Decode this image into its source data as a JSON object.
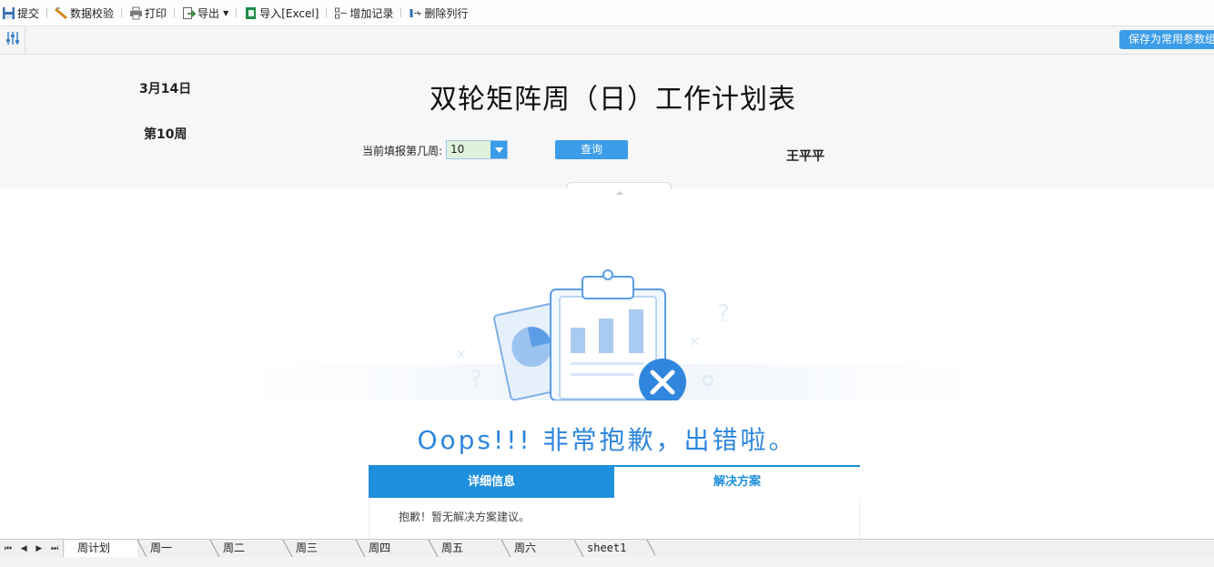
{
  "toolbar": {
    "submit": "提交",
    "validate": "数据校验",
    "print": "打印",
    "export": "导出",
    "import": "导入[Excel]",
    "add_record": "增加记录",
    "delete_row": "删除列行"
  },
  "parambar": {
    "save_params": "保存为常用参数组"
  },
  "panel": {
    "date": "3月14日",
    "week": "第10周",
    "title": "双轮矩阵周（日）工作计划表",
    "week_query_label": "当前填报第几周:",
    "week_value": "10",
    "query_button": "查询",
    "user": "王平平"
  },
  "error": {
    "heading": "Oops!!! 非常抱歉，出错啦。",
    "tab_details": "详细信息",
    "tab_solution": "解决方案",
    "body": "抱歉！暂无解决方案建议。"
  },
  "sheets": [
    "周计划",
    "周一",
    "周二",
    "周三",
    "周四",
    "周五",
    "周六",
    "sheet1"
  ],
  "colors": {
    "accent": "#1e8fdc",
    "button": "#3b9ce8",
    "input_bg": "#dff2dc"
  }
}
